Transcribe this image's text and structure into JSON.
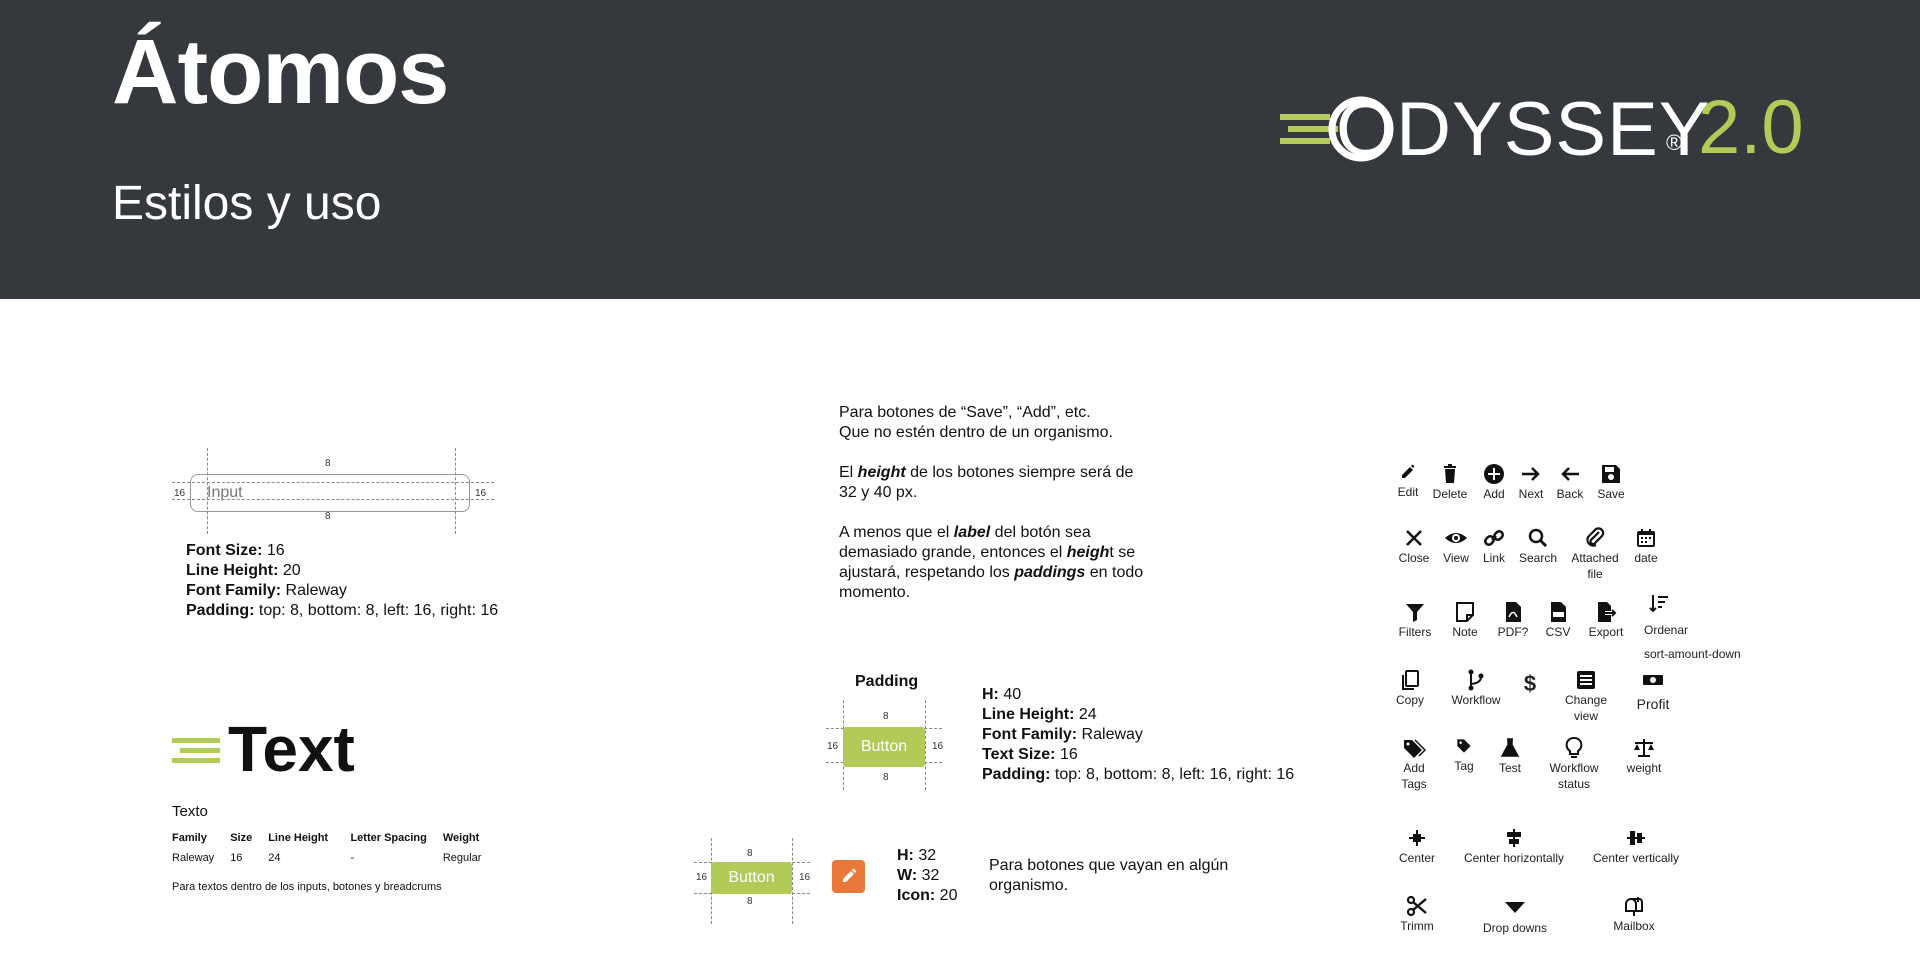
{
  "header": {
    "title": "Átomos",
    "subtitle": "Estilos y uso",
    "logo_word": "ODYSSEY",
    "logo_reg": "®",
    "logo_version": "2.0"
  },
  "input_spec": {
    "placeholder": "Input",
    "pad_top": "8",
    "pad_bottom": "8",
    "pad_left": "16",
    "pad_right": "16",
    "props": [
      {
        "k": "Font Size:",
        "v": " 16"
      },
      {
        "k": "Line Height:",
        "v": " 20"
      },
      {
        "k": "Font Family:",
        "v": " Raleway"
      },
      {
        "k": "Padding:",
        "v": " top: 8, bottom: 8, left: 16, right: 16"
      }
    ]
  },
  "text_spec": {
    "heading": "Text",
    "label": "Texto",
    "columns": [
      "Family",
      "Size",
      "Line Height",
      "Letter Spacing",
      "Weight"
    ],
    "row": [
      "Raleway",
      "16",
      "24",
      "-",
      "Regular"
    ],
    "note": "Para textos dentro de los inputs, botones y breadcrums"
  },
  "buttons_text": {
    "line1": "Para botones de “Save”, “Add”, etc.",
    "line2": "Que no estén dentro de un organismo.",
    "height_a": "El ",
    "height_b": "height",
    "height_c": " de los botones siempre será de",
    "height_d": "32 y 40 px.",
    "label_a": "A menos que el ",
    "label_b": "label",
    "label_c": " del botón sea",
    "label_d": "demasiado grande, entonces el ",
    "label_e": "heigh",
    "label_f": "t se",
    "label_g": "ajustará, respetando los ",
    "label_h": "paddings",
    "label_i": " en todo",
    "label_j": "momento."
  },
  "button40": {
    "padding_title": "Padding",
    "label": "Button",
    "pad_top": "8",
    "pad_bottom": "8",
    "pad_left": "16",
    "pad_right": "16",
    "props": [
      {
        "k": "H:",
        "v": " 40"
      },
      {
        "k": "Line Height:",
        "v": " 24"
      },
      {
        "k": "Font Family:",
        "v": " Raleway"
      },
      {
        "k": "Text Size:",
        "v": " 16"
      },
      {
        "k": "Padding:",
        "v": " top: 8, bottom: 8, left: 16, right: 16"
      }
    ]
  },
  "button32": {
    "label": "Button",
    "pad_top": "8",
    "pad_bottom": "8",
    "pad_left": "16",
    "pad_right": "16",
    "props": [
      {
        "k": "H:",
        "v": " 32"
      },
      {
        "k": "W:",
        "v": " 32"
      },
      {
        "k": "Icon:",
        "v": " 20"
      }
    ],
    "note_line1": "Para botones que vayan en algún",
    "note_line2": "organismo."
  },
  "icons": {
    "row1": [
      "Edit",
      "Delete",
      "Add",
      "Next",
      "Back",
      "Save"
    ],
    "row2": [
      "Close",
      "View",
      "Link",
      "Search",
      "Attached",
      "file",
      "date"
    ],
    "row3": [
      "Filters",
      "Note",
      "PDF?",
      "CSV",
      "Export",
      "Ordenar",
      "sort-amount-down"
    ],
    "row4": [
      "Copy",
      "Workflow",
      "Change",
      "view",
      "Profit"
    ],
    "row5": [
      "Add",
      "Tags",
      "Tag",
      "Test",
      "Workflow",
      "status",
      "weight"
    ],
    "row6": [
      "Center",
      "Center horizontally",
      "Center vertically"
    ],
    "row7": [
      "Trimm",
      "Drop downs",
      "Mailbox"
    ]
  },
  "colors": {
    "header_bg": "#35383d",
    "accent_green": "#b2cb58",
    "orange": "#e8793a"
  }
}
